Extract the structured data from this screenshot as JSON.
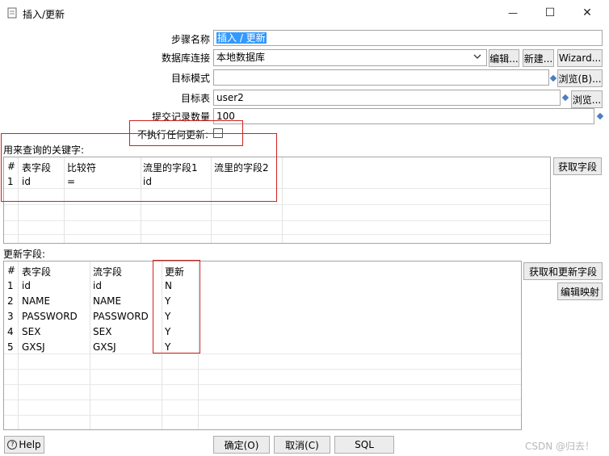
{
  "window": {
    "title": "插入/更新",
    "minimize_glyph": "—",
    "maximize_glyph": "☐",
    "close_glyph": "✕"
  },
  "form": {
    "step_name_label": "步骤名称",
    "step_name_value": "插入 / 更新",
    "db_conn_label": "数据库连接",
    "db_conn_value": "本地数据库",
    "edit_button": "编辑...",
    "new_button": "新建...",
    "wizard_button": "Wizard...",
    "target_schema_label": "目标模式",
    "target_schema_value": "",
    "browse_schema_button": "浏览(B)...",
    "target_table_label": "目标表",
    "target_table_value": "user2",
    "browse_table_button": "浏览...",
    "commit_size_label": "提交记录数量",
    "commit_size_value": "100",
    "no_update_label": "不执行任何更新:"
  },
  "keys": {
    "section_label": "用来查询的关键字:",
    "get_fields_button": "获取字段",
    "columns": [
      "#",
      "表字段",
      "比较符",
      "流里的字段1",
      "流里的字段2"
    ],
    "rows": [
      [
        "1",
        "id",
        "=",
        "id",
        ""
      ]
    ]
  },
  "update": {
    "section_label": "更新字段:",
    "get_update_fields_button": "获取和更新字段",
    "edit_mapping_button": "编辑映射",
    "columns": [
      "#",
      "表字段",
      "流字段",
      "更新"
    ],
    "rows": [
      [
        "1",
        "id",
        "id",
        "N"
      ],
      [
        "2",
        "NAME",
        "NAME",
        "Y"
      ],
      [
        "3",
        "PASSWORD",
        "PASSWORD",
        "Y"
      ],
      [
        "4",
        "SEX",
        "SEX",
        "Y"
      ],
      [
        "5",
        "GXSJ",
        "GXSJ",
        "Y"
      ]
    ]
  },
  "footer": {
    "help_button": "Help",
    "ok_button": "确定(O)",
    "cancel_button": "取消(C)",
    "sql_button": "SQL",
    "watermark": "CSDN @归去！"
  },
  "colors": {
    "selection": "#3399ff",
    "highlight_box": "#d02020",
    "link_diamond": "#4a7fbf"
  }
}
